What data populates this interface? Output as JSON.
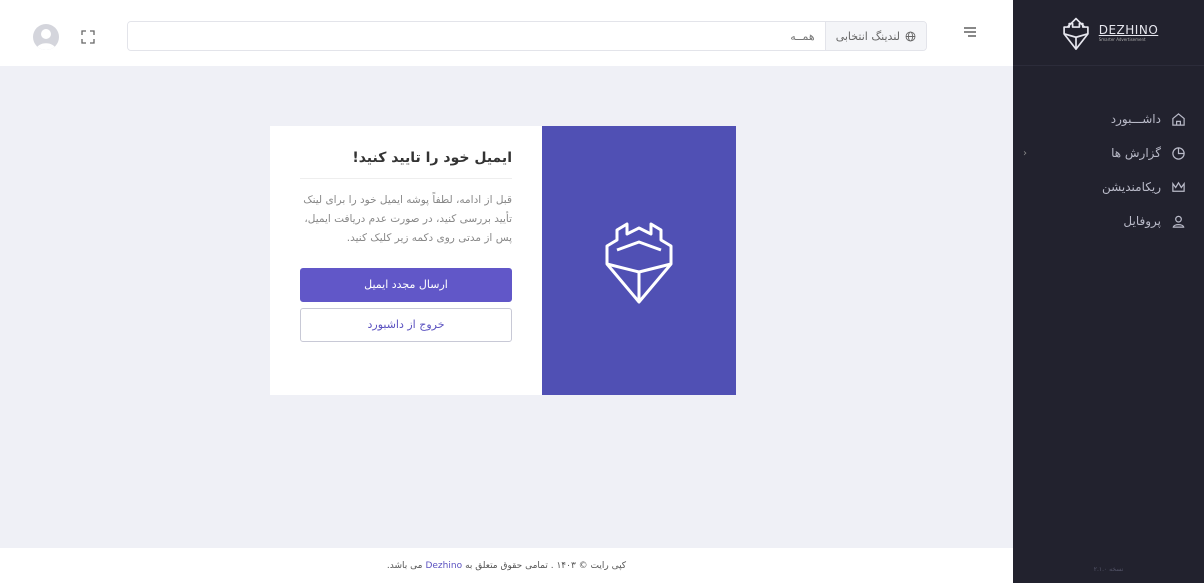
{
  "sidebar": {
    "brand": {
      "name": "DEZHINO",
      "tagline": "Smarter Advertisement"
    },
    "items": [
      {
        "label": "داشـــبورد",
        "icon": "home-icon"
      },
      {
        "label": "گزارش ها",
        "icon": "chart-pie-icon",
        "expandable": true
      },
      {
        "label": "ریکامندیشن",
        "icon": "crown-icon"
      },
      {
        "label": "پروفایل",
        "icon": "user-icon"
      }
    ],
    "version": "نسخه ۲.۱.۰"
  },
  "header": {
    "search_prefix": "لندینگ انتخابی",
    "search_placeholder": "همــه"
  },
  "card": {
    "title": "ایمیل خود را تایید کنید!",
    "text": "قبل از ادامه، لطفاً پوشه ایمیل خود را برای لینک تأیید بررسی کنید، در صورت عدم دریافت ایمیل، پس از مدتی روی دکمه زیر کلیک کنید.",
    "resend_label": "ارسال مجدد ایمیل",
    "logout_label": "خروج از داشبورد"
  },
  "footer": {
    "copyright_pre": "کپی رایت © ۱۴۰۳ . تمامی حقوق متعلق به",
    "brand_link": "Dezhino",
    "copyright_post": "می باشد."
  },
  "colors": {
    "sidebar_bg": "#22222e",
    "accent": "#5050b4",
    "button": "#6157c8",
    "page_bg": "#eff0f6"
  }
}
